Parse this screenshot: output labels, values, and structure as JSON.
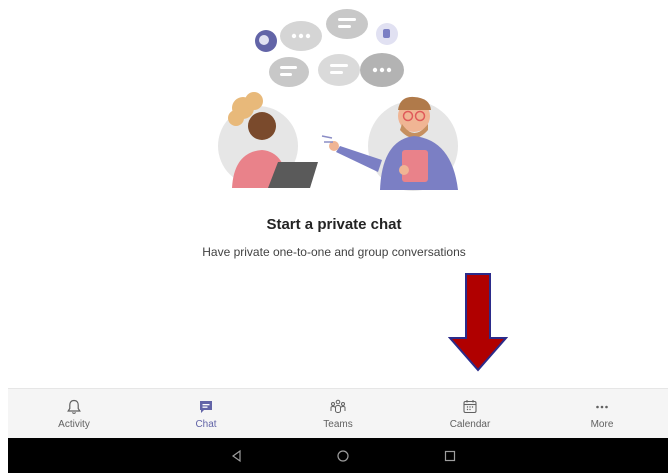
{
  "empty_state": {
    "title": "Start a private chat",
    "subtitle": "Have private one-to-one and group conversations"
  },
  "annotation": {
    "arrow_color": "#b00000",
    "arrow_outline": "#2b2b8a"
  },
  "nav": {
    "active_color": "#6264a7",
    "items": [
      {
        "label": "Activity",
        "icon": "bell-icon"
      },
      {
        "label": "Chat",
        "icon": "chat-icon"
      },
      {
        "label": "Teams",
        "icon": "teams-icon"
      },
      {
        "label": "Calendar",
        "icon": "calendar-icon"
      },
      {
        "label": "More",
        "icon": "more-icon"
      }
    ]
  },
  "system_bar": {
    "buttons": [
      "back-icon",
      "home-icon",
      "recents-icon"
    ]
  }
}
